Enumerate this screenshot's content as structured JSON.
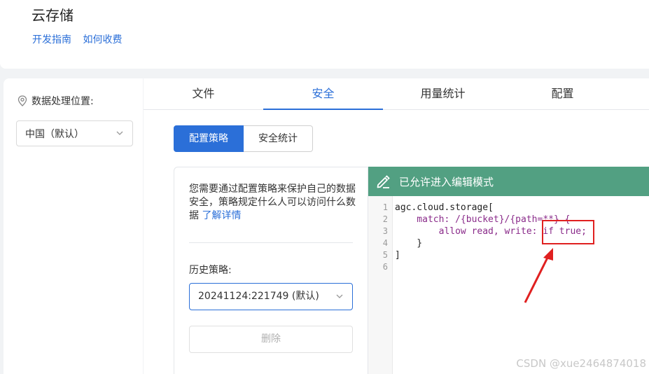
{
  "header": {
    "title": "云存储",
    "links": [
      "开发指南",
      "如何收费"
    ]
  },
  "left": {
    "location_label": "数据处理位置:",
    "region_value": "中国（默认）"
  },
  "tabs": [
    "文件",
    "安全",
    "用量统计",
    "配置"
  ],
  "active_tab": "安全",
  "segment": {
    "items": [
      "配置策略",
      "安全统计"
    ],
    "active": "配置策略"
  },
  "policy": {
    "description": "您需要通过配置策略来保护自己的数据安全，策略规定什么人可以访问什么数据",
    "learn_more": "了解详情",
    "history_label": "历史策略:",
    "history_value": "20241124:221749 (默认)",
    "delete_label": "删除"
  },
  "editor": {
    "banner": "已允许进入编辑模式",
    "line_numbers": [
      "1",
      "2",
      "3",
      "4",
      "5",
      "6"
    ],
    "lines": [
      "agc.cloud.storage[",
      "    match: /{bucket}/{path=**} {",
      "        allow read, write: if true;",
      "    }",
      "]",
      ""
    ]
  },
  "colors": {
    "accent": "#2b6fd8",
    "banner_green": "#52a082",
    "annotation_red": "#e02020"
  },
  "watermark": "CSDN @xue2464874018"
}
